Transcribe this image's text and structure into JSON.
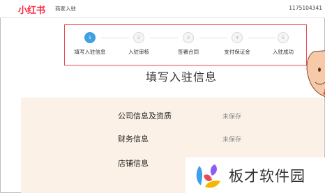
{
  "header": {
    "logo_text": "小红书",
    "section_name": "商家入驻",
    "account_id": "1175104341"
  },
  "steps": [
    {
      "number": "1",
      "label": "填写入驻信息",
      "active": true
    },
    {
      "number": "2",
      "label": "入驻审核",
      "active": false
    },
    {
      "number": "3",
      "label": "签署合同",
      "active": false
    },
    {
      "number": "4",
      "label": "支付保证金",
      "active": false
    },
    {
      "number": "5",
      "label": "入驻成功",
      "active": false
    }
  ],
  "main": {
    "title": "填写入驻信息",
    "rows": [
      {
        "label": "公司信息及资质",
        "status": "未保存"
      },
      {
        "label": "财务信息",
        "status": "未保存"
      },
      {
        "label": "店铺信息",
        "status": ""
      }
    ]
  },
  "watermark": {
    "text": "板才软件园"
  },
  "colors": {
    "brand": "#ff2442",
    "active_step": "#3fa1e4",
    "step_box_border": "#e94b55",
    "panel_bg": "#fbf1e6"
  }
}
